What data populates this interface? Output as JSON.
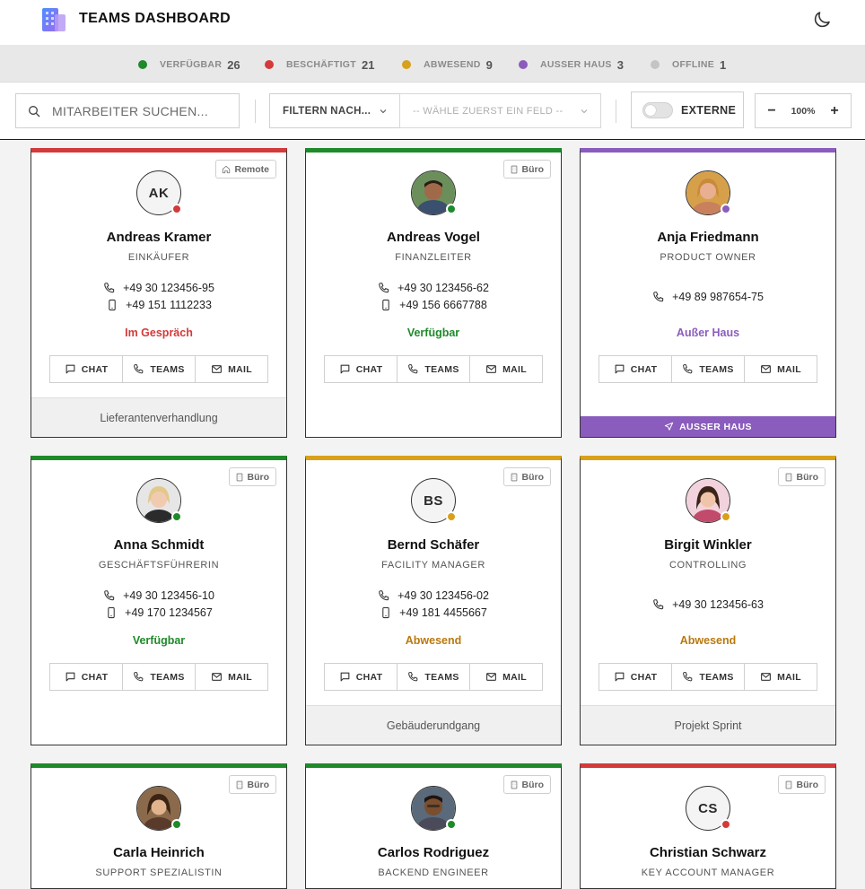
{
  "app": {
    "title": "TEAMS DASHBOARD"
  },
  "colors": {
    "available": "#1e8a2a",
    "busy": "#d33a3a",
    "absent": "#d9a01a",
    "out": "#8a5cbd",
    "offline": "#bdbdbd"
  },
  "stats": [
    {
      "label": "VERFÜGBAR",
      "count": "26"
    },
    {
      "label": "BESCHÄFTIGT",
      "count": "21"
    },
    {
      "label": "ABWESEND",
      "count": "9"
    },
    {
      "label": "AUSSER HAUS",
      "count": "3"
    },
    {
      "label": "OFFLINE",
      "count": "1"
    }
  ],
  "toolbar": {
    "search_placeholder": "MITARBEITER SUCHEN...",
    "filter_label": "FILTERN NACH...",
    "field_placeholder": "-- WÄHLE ZUERST EIN FELD --",
    "external_label": "EXTERNE",
    "external_on": false,
    "zoom_minus": "−",
    "zoom_plus": "+",
    "zoom_value": "100%"
  },
  "actions": {
    "chat": "CHAT",
    "teams": "TEAMS",
    "mail": "MAIL"
  },
  "cards": [
    {
      "name": "Andreas Kramer",
      "role": "EINKÄUFER",
      "initials": "AK",
      "location": "Remote",
      "status": "busy",
      "status_text": "Im Gespräch",
      "phone": "+49 30 123456-95",
      "mobile": "+49 151 1112233",
      "note": "Lieferantenverhandlung"
    },
    {
      "name": "Andreas Vogel",
      "role": "FINANZLEITER",
      "initials": "",
      "location": "Büro",
      "status": "available",
      "status_text": "Verfügbar",
      "phone": "+49 30 123456-62",
      "mobile": "+49 156 6667788",
      "note": ""
    },
    {
      "name": "Anja Friedmann",
      "role": "PRODUCT OWNER",
      "initials": "",
      "location": "",
      "status": "out",
      "status_text": "Außer Haus",
      "phone": "+49 89 987654-75",
      "mobile": "",
      "away_banner": "AUSSER HAUS"
    },
    {
      "name": "Anna Schmidt",
      "role": "GESCHÄFTSFÜHRERIN",
      "initials": "",
      "location": "Büro",
      "status": "available",
      "status_text": "Verfügbar",
      "phone": "+49 30 123456-10",
      "mobile": "+49 170 1234567",
      "note": ""
    },
    {
      "name": "Bernd Schäfer",
      "role": "FACILITY MANAGER",
      "initials": "BS",
      "location": "Büro",
      "status": "absent",
      "status_text": "Abwesend",
      "phone": "+49 30 123456-02",
      "mobile": "+49 181 4455667",
      "note": "Gebäuderundgang"
    },
    {
      "name": "Birgit Winkler",
      "role": "CONTROLLING",
      "initials": "",
      "location": "Büro",
      "status": "absent",
      "status_text": "Abwesend",
      "phone": "+49 30 123456-63",
      "mobile": "",
      "note": "Projekt Sprint"
    },
    {
      "name": "Carla Heinrich",
      "role": "SUPPORT SPEZIALISTIN",
      "initials": "",
      "location": "Büro",
      "status": "available"
    },
    {
      "name": "Carlos Rodriguez",
      "role": "BACKEND ENGINEER",
      "initials": "",
      "location": "Büro",
      "status": "available"
    },
    {
      "name": "Christian Schwarz",
      "role": "KEY ACCOUNT MANAGER",
      "initials": "CS",
      "location": "Büro",
      "status": "busy"
    }
  ]
}
